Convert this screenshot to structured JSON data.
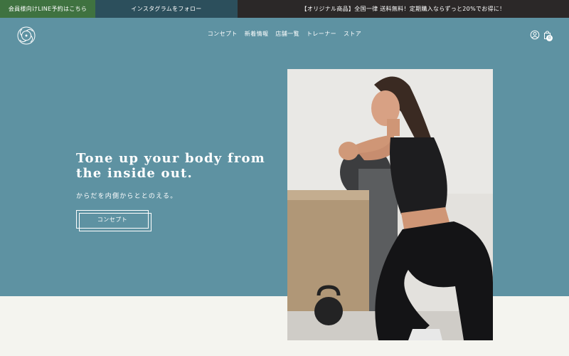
{
  "topbar": {
    "line_label": "会員様向けLINE予約はこちら",
    "instagram_label": "インスタグラムをフォロー",
    "promo_text": "【オリジナル商品】全国一律 送料無料！定期購入ならずっと20%でお得に！",
    "colors": {
      "line": "#3f7240",
      "instagram": "#2c4f5c",
      "promo": "#2b2828"
    }
  },
  "header": {
    "logo_icon": "swirl-logo-icon",
    "nav": [
      {
        "label": "コンセプト"
      },
      {
        "label": "新着情報"
      },
      {
        "label": "店舗一覧"
      },
      {
        "label": "トレーナー"
      },
      {
        "label": "ストア"
      }
    ],
    "account_icon": "user-icon",
    "cart_icon": "bag-icon",
    "cart_count": "0"
  },
  "hero": {
    "background": "#5e92a2",
    "title": "Tone up your body from the inside out.",
    "subtitle": "からだを内側からととのえる。",
    "button_label": "コンセプト",
    "image_icon": "woman-squat-photo"
  }
}
